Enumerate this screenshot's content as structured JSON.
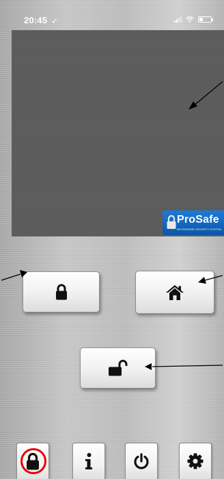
{
  "status_bar": {
    "time": "20:45",
    "location_icon": "location-arrow-icon",
    "signal_icon": "cellular-signal-icon",
    "wifi_icon": "wifi-icon",
    "battery_icon": "battery-icon"
  },
  "video": {
    "brand_name": "ProSafe",
    "brand_tagline": "MOTORHOME SECURITY SYSTEM",
    "brand_icon": "padlock-icon"
  },
  "controls": {
    "lock_icon": "lock-closed-icon",
    "home_icon": "home-icon",
    "unlock_icon": "lock-open-icon"
  },
  "tabbar": {
    "items": [
      {
        "icon": "lock-closed-icon",
        "active": true
      },
      {
        "icon": "info-icon",
        "active": false
      },
      {
        "icon": "power-icon",
        "active": false
      },
      {
        "icon": "gear-icon",
        "active": false
      }
    ]
  },
  "colors": {
    "active_ring": "#e30000",
    "brand_blue": "#0b56a8",
    "video_bg": "#5a5a5a",
    "icon": "#111111"
  }
}
